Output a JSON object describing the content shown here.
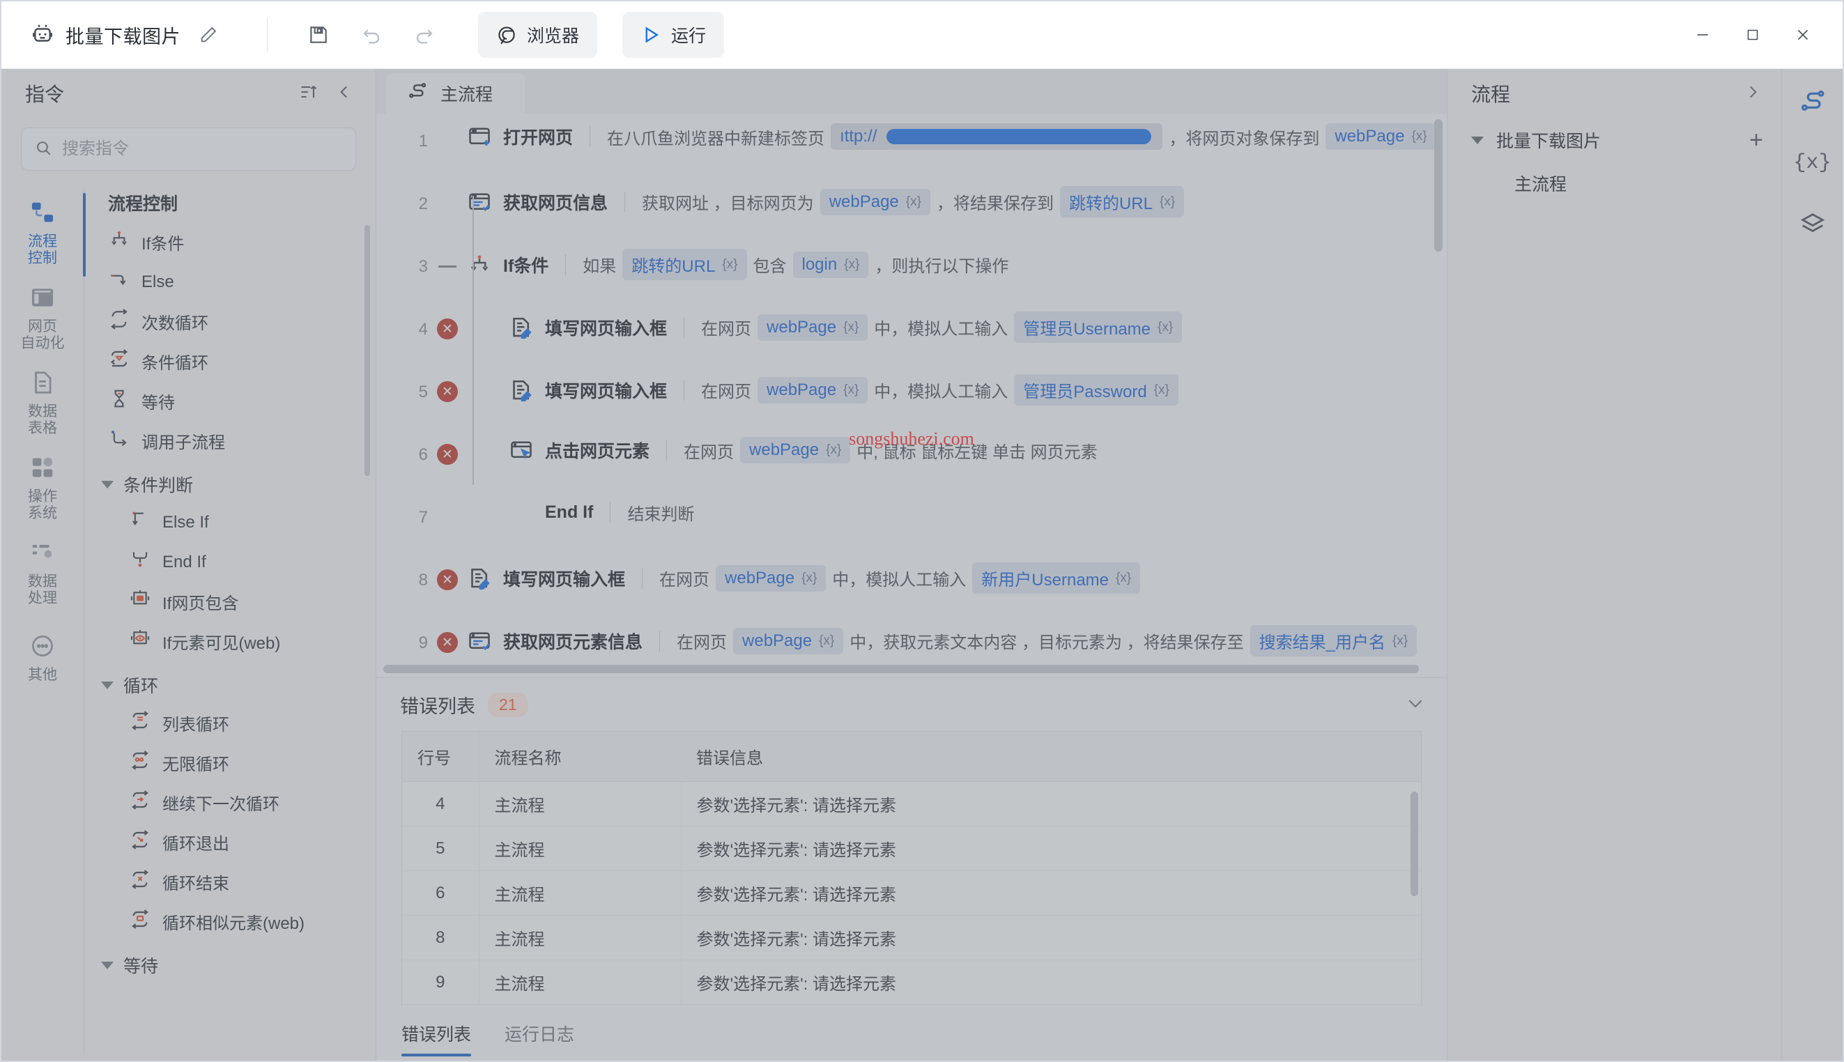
{
  "titlebar": {
    "app_title": "批量下载图片",
    "robot_icon": "robot-icon",
    "edit_icon": "pencil-edit-icon",
    "save_icon": "save-icon",
    "undo_icon": "undo-icon",
    "redo_icon": "redo-icon",
    "browser_label": "浏览器",
    "browser_icon": "browser-globe-icon",
    "run_label": "运行",
    "run_icon": "play-icon",
    "minimize": "minimize-icon",
    "maximize": "maximize-icon",
    "close": "close-icon"
  },
  "left_panel": {
    "title": "指令",
    "sort_icon": "sort-list-icon",
    "collapse_icon": "chevron-left-icon",
    "search": {
      "value": "",
      "placeholder": "搜索指令"
    },
    "categories": [
      {
        "label": "流程控制",
        "icon": "flow-control-icon",
        "active": true
      },
      {
        "label": "网页自动化",
        "icon": "web-automation-icon",
        "active": false
      },
      {
        "label": "数据表格",
        "icon": "data-table-icon",
        "active": false
      },
      {
        "label": "操作系统",
        "icon": "operating-system-icon",
        "active": false
      },
      {
        "label": "数据处理",
        "icon": "data-processing-icon",
        "active": false
      },
      {
        "label": "其他",
        "icon": "more-ellipsis-icon",
        "active": false
      }
    ],
    "group_title": "流程控制",
    "items": [
      {
        "label": "If条件",
        "icon": "if-condition-icon",
        "indent": false
      },
      {
        "label": "Else",
        "icon": "else-icon",
        "indent": false
      },
      {
        "label": "次数循环",
        "icon": "count-loop-icon",
        "indent": false
      },
      {
        "label": "条件循环",
        "icon": "condition-loop-icon",
        "indent": false
      },
      {
        "label": "等待",
        "icon": "hourglass-wait-icon",
        "indent": false
      },
      {
        "label": "调用子流程",
        "icon": "call-subflow-icon",
        "indent": false
      }
    ],
    "subgroups": [
      {
        "title": "条件判断",
        "items": [
          {
            "label": "Else If",
            "icon": "else-if-icon"
          },
          {
            "label": "End If",
            "icon": "end-if-icon"
          },
          {
            "label": "If网页包含",
            "icon": "if-page-contains-icon"
          },
          {
            "label": "If元素可见(web)",
            "icon": "if-element-visible-icon"
          }
        ]
      },
      {
        "title": "循环",
        "items": [
          {
            "label": "列表循环",
            "icon": "list-loop-icon"
          },
          {
            "label": "无限循环",
            "icon": "infinite-loop-icon"
          },
          {
            "label": "继续下一次循环",
            "icon": "continue-loop-icon"
          },
          {
            "label": "循环退出",
            "icon": "break-loop-icon"
          },
          {
            "label": "循环结束",
            "icon": "end-loop-icon"
          },
          {
            "label": "循环相似元素(web)",
            "icon": "loop-similar-elements-icon"
          }
        ]
      },
      {
        "title": "等待",
        "items": []
      }
    ]
  },
  "center": {
    "tab": {
      "label": "主流程",
      "icon": "flow-s-icon"
    },
    "watermark": "songshuhezi.com",
    "steps": [
      {
        "no": "1",
        "name": "打开网页",
        "icon": "open-webpage-icon",
        "error": false,
        "nested": false,
        "collapse": false,
        "parts": [
          {
            "type": "text",
            "text": "在八爪鱼浏览器中新建标签页"
          },
          {
            "type": "chip-redact",
            "text": "ıttp://"
          },
          {
            "type": "text",
            "text": "，将网页对象保存到"
          },
          {
            "type": "chip",
            "text": "webPage"
          }
        ]
      },
      {
        "no": "2",
        "name": "获取网页信息",
        "icon": "get-webpage-info-icon",
        "error": false,
        "nested": false,
        "collapse": false,
        "parts": [
          {
            "type": "text",
            "text": "获取网址 ，目标网页为"
          },
          {
            "type": "chip",
            "text": "webPage"
          },
          {
            "type": "text",
            "text": "，将结果保存到"
          },
          {
            "type": "chip",
            "text": "跳转的URL"
          }
        ]
      },
      {
        "no": "3",
        "name": "If条件",
        "icon": "if-condition-icon",
        "error": false,
        "nested": false,
        "collapse": true,
        "parts": [
          {
            "type": "text",
            "text": "如果"
          },
          {
            "type": "chip",
            "text": "跳转的URL"
          },
          {
            "type": "text",
            "text": "包含"
          },
          {
            "type": "chip",
            "text": "login"
          },
          {
            "type": "text",
            "text": "，则执行以下操作"
          }
        ]
      },
      {
        "no": "4",
        "name": "填写网页输入框",
        "icon": "fill-input-icon",
        "error": true,
        "nested": true,
        "collapse": false,
        "parts": [
          {
            "type": "text",
            "text": "在网页"
          },
          {
            "type": "chip",
            "text": "webPage"
          },
          {
            "type": "text",
            "text": "中，模拟人工输入"
          },
          {
            "type": "chip",
            "text": "管理员Username"
          }
        ]
      },
      {
        "no": "5",
        "name": "填写网页输入框",
        "icon": "fill-input-icon",
        "error": true,
        "nested": true,
        "collapse": false,
        "parts": [
          {
            "type": "text",
            "text": "在网页"
          },
          {
            "type": "chip",
            "text": "webPage"
          },
          {
            "type": "text",
            "text": "中，模拟人工输入"
          },
          {
            "type": "chip",
            "text": "管理员Password"
          }
        ]
      },
      {
        "no": "6",
        "name": "点击网页元素",
        "icon": "click-element-icon",
        "error": true,
        "nested": true,
        "collapse": false,
        "parts": [
          {
            "type": "text",
            "text": "在网页"
          },
          {
            "type": "chip",
            "text": "webPage"
          },
          {
            "type": "text",
            "text": "中, 鼠标 鼠标左键 单击 网页元素"
          }
        ]
      },
      {
        "no": "7",
        "name": "End If",
        "icon": "none",
        "error": false,
        "nested": true,
        "collapse": false,
        "endif": true,
        "parts": [
          {
            "type": "text",
            "text": "结束判断"
          }
        ]
      },
      {
        "no": "8",
        "name": "填写网页输入框",
        "icon": "fill-input-icon",
        "error": true,
        "nested": false,
        "collapse": false,
        "parts": [
          {
            "type": "text",
            "text": "在网页"
          },
          {
            "type": "chip",
            "text": "webPage"
          },
          {
            "type": "text",
            "text": "中，模拟人工输入"
          },
          {
            "type": "chip",
            "text": "新用户Username"
          }
        ]
      },
      {
        "no": "9",
        "name": "获取网页元素信息",
        "icon": "get-element-info-icon",
        "error": true,
        "nested": false,
        "collapse": false,
        "parts": [
          {
            "type": "text",
            "text": "在网页"
          },
          {
            "type": "chip",
            "text": "webPage"
          },
          {
            "type": "text",
            "text": "中，获取元素文本内容 ，目标元素为 ，将结果保存至"
          },
          {
            "type": "chip",
            "text": "搜索结果_用户名"
          }
        ]
      }
    ]
  },
  "error_panel": {
    "title": "错误列表",
    "count": "21",
    "collapse_icon": "chevron-down-icon",
    "columns": [
      "行号",
      "流程名称",
      "错误信息"
    ],
    "rows": [
      [
        "4",
        "主流程",
        "参数'选择元素': 请选择元素"
      ],
      [
        "5",
        "主流程",
        "参数'选择元素': 请选择元素"
      ],
      [
        "6",
        "主流程",
        "参数'选择元素': 请选择元素"
      ],
      [
        "8",
        "主流程",
        "参数'选择元素': 请选择元素"
      ],
      [
        "9",
        "主流程",
        "参数'选择元素': 请选择元素"
      ]
    ],
    "tabs": [
      {
        "label": "错误列表",
        "active": true
      },
      {
        "label": "运行日志",
        "active": false
      }
    ]
  },
  "right_panel": {
    "title": "流程",
    "expand_icon": "chevron-right-icon",
    "tree_root": "批量下载图片",
    "add_icon": "plus-icon",
    "tree_child": "主流程",
    "rail": [
      {
        "icon": "flow-s-icon",
        "active": true
      },
      {
        "icon": "variables-icon",
        "label": "{x}",
        "active": false
      },
      {
        "icon": "layers-icon",
        "active": false
      }
    ]
  },
  "colors": {
    "accent": "#1763c7",
    "chip_bg": "#dde4f0",
    "chip_text": "#1a64d8",
    "error_red": "#c0392b",
    "badge_bg": "#fde9e2",
    "badge_text": "#e8643c",
    "watermark": "#ff2a2a"
  }
}
